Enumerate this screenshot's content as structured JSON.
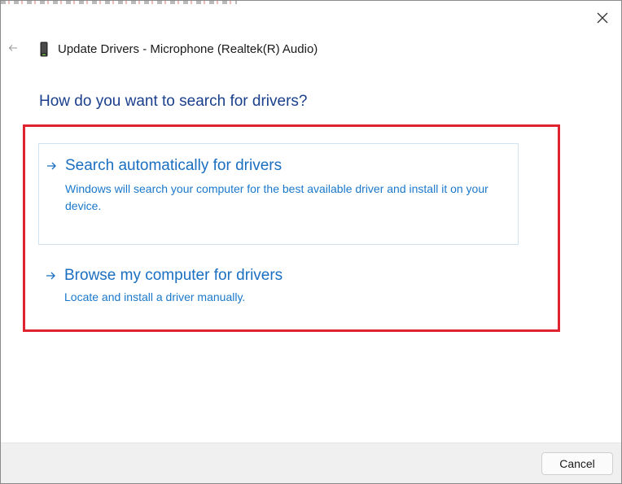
{
  "window": {
    "title": "Update Drivers - Microphone (Realtek(R) Audio)"
  },
  "heading": "How do you want to search for drivers?",
  "options": [
    {
      "title": "Search automatically for drivers",
      "description": "Windows will search your computer for the best available driver and install it on your device."
    },
    {
      "title": "Browse my computer for drivers",
      "description": "Locate and install a driver manually."
    }
  ],
  "footer": {
    "cancel_label": "Cancel"
  },
  "icons": {
    "close": "close-icon",
    "back": "back-arrow-icon",
    "device": "microphone-device-icon",
    "option_arrow": "arrow-right-icon"
  },
  "colors": {
    "heading": "#1a3f8c",
    "option_link": "#1a6fc0",
    "highlight_border": "#e0232e",
    "footer_bg": "#f0f0f0"
  }
}
